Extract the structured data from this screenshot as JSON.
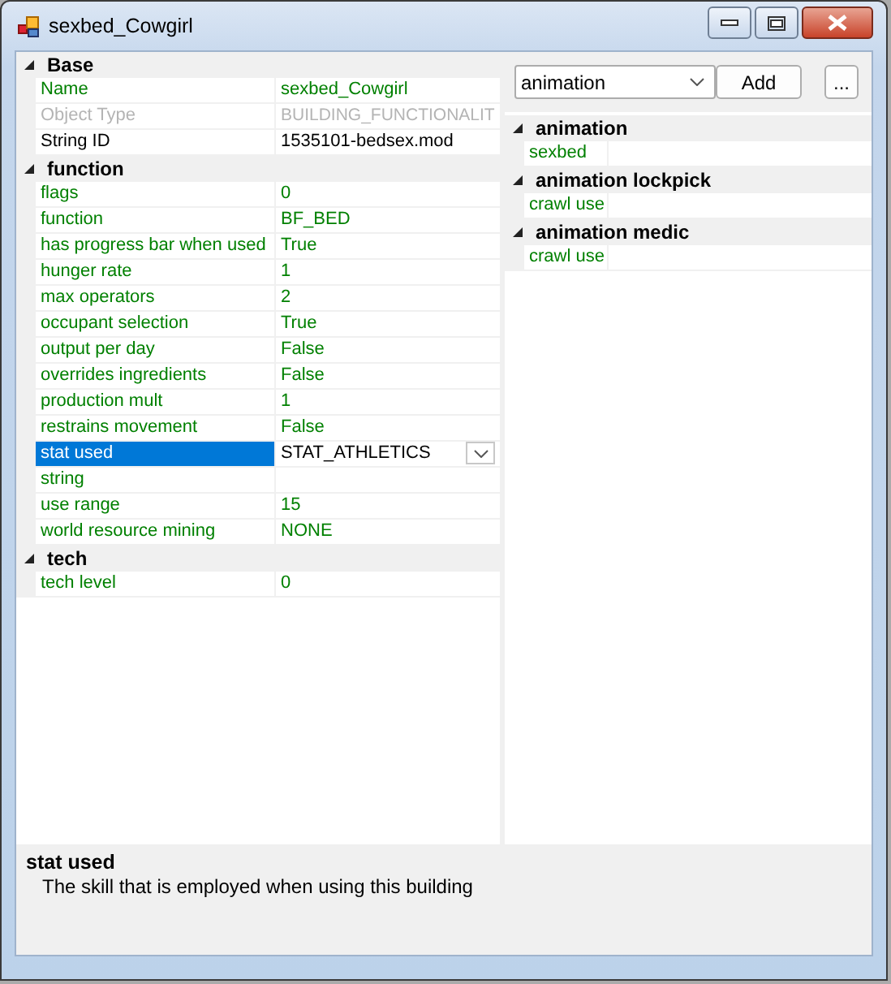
{
  "window": {
    "title": "sexbed_Cowgirl"
  },
  "properties": [
    {
      "category": "Base",
      "expanded": true,
      "rows": [
        {
          "name": "Name",
          "value": "sexbed_Cowgirl",
          "modified": true,
          "disabled": false,
          "selected": false
        },
        {
          "name": "Object Type",
          "value": "BUILDING_FUNCTIONALIT",
          "disabled": true,
          "selected": false
        },
        {
          "name": "String ID",
          "value": "1535101-bedsex.mod",
          "modified": false,
          "disabled": false,
          "selected": false
        }
      ]
    },
    {
      "category": "function",
      "expanded": true,
      "rows": [
        {
          "name": "flags",
          "value": "0",
          "modified": true,
          "disabled": false,
          "selected": false
        },
        {
          "name": "function",
          "value": "BF_BED",
          "modified": true,
          "disabled": false,
          "selected": false
        },
        {
          "name": "has progress bar when used",
          "value": "True",
          "modified": true,
          "disabled": false,
          "selected": false
        },
        {
          "name": "hunger rate",
          "value": "1",
          "modified": true,
          "disabled": false,
          "selected": false
        },
        {
          "name": "max operators",
          "value": "2",
          "modified": true,
          "disabled": false,
          "selected": false
        },
        {
          "name": "occupant selection",
          "value": "True",
          "modified": true,
          "disabled": false,
          "selected": false
        },
        {
          "name": "output per day",
          "value": "False",
          "modified": true,
          "disabled": false,
          "selected": false
        },
        {
          "name": "overrides ingredients",
          "value": "False",
          "modified": true,
          "disabled": false,
          "selected": false
        },
        {
          "name": "production mult",
          "value": "1",
          "modified": true,
          "disabled": false,
          "selected": false
        },
        {
          "name": "restrains movement",
          "value": "False",
          "modified": true,
          "disabled": false,
          "selected": false
        },
        {
          "name": "stat used",
          "value": "STAT_ATHLETICS",
          "modified": true,
          "disabled": false,
          "selected": true
        },
        {
          "name": "string",
          "modified": true,
          "disabled": false,
          "selected": false
        },
        {
          "name": "use range",
          "value": "15",
          "modified": true,
          "disabled": false,
          "selected": false
        },
        {
          "name": "world resource mining",
          "value": "NONE",
          "modified": true,
          "disabled": false,
          "selected": false
        }
      ]
    },
    {
      "category": "tech",
      "expanded": true,
      "rows": [
        {
          "name": "tech level",
          "value": "0",
          "modified": true,
          "disabled": false,
          "selected": false
        }
      ]
    }
  ],
  "editor": {
    "dropdown": "animation",
    "add_button": "Add",
    "more_button": "..."
  },
  "lists": [
    {
      "category": "animation",
      "expanded": true,
      "rows": [
        {
          "name": "sexbed"
        }
      ]
    },
    {
      "category": "animation lockpick",
      "expanded": true,
      "rows": [
        {
          "name": "crawl use"
        }
      ]
    },
    {
      "category": "animation medic",
      "expanded": true,
      "rows": [
        {
          "name": "crawl use"
        }
      ]
    }
  ],
  "help": {
    "title": "stat used",
    "description": "The skill that is employed when using this building"
  }
}
